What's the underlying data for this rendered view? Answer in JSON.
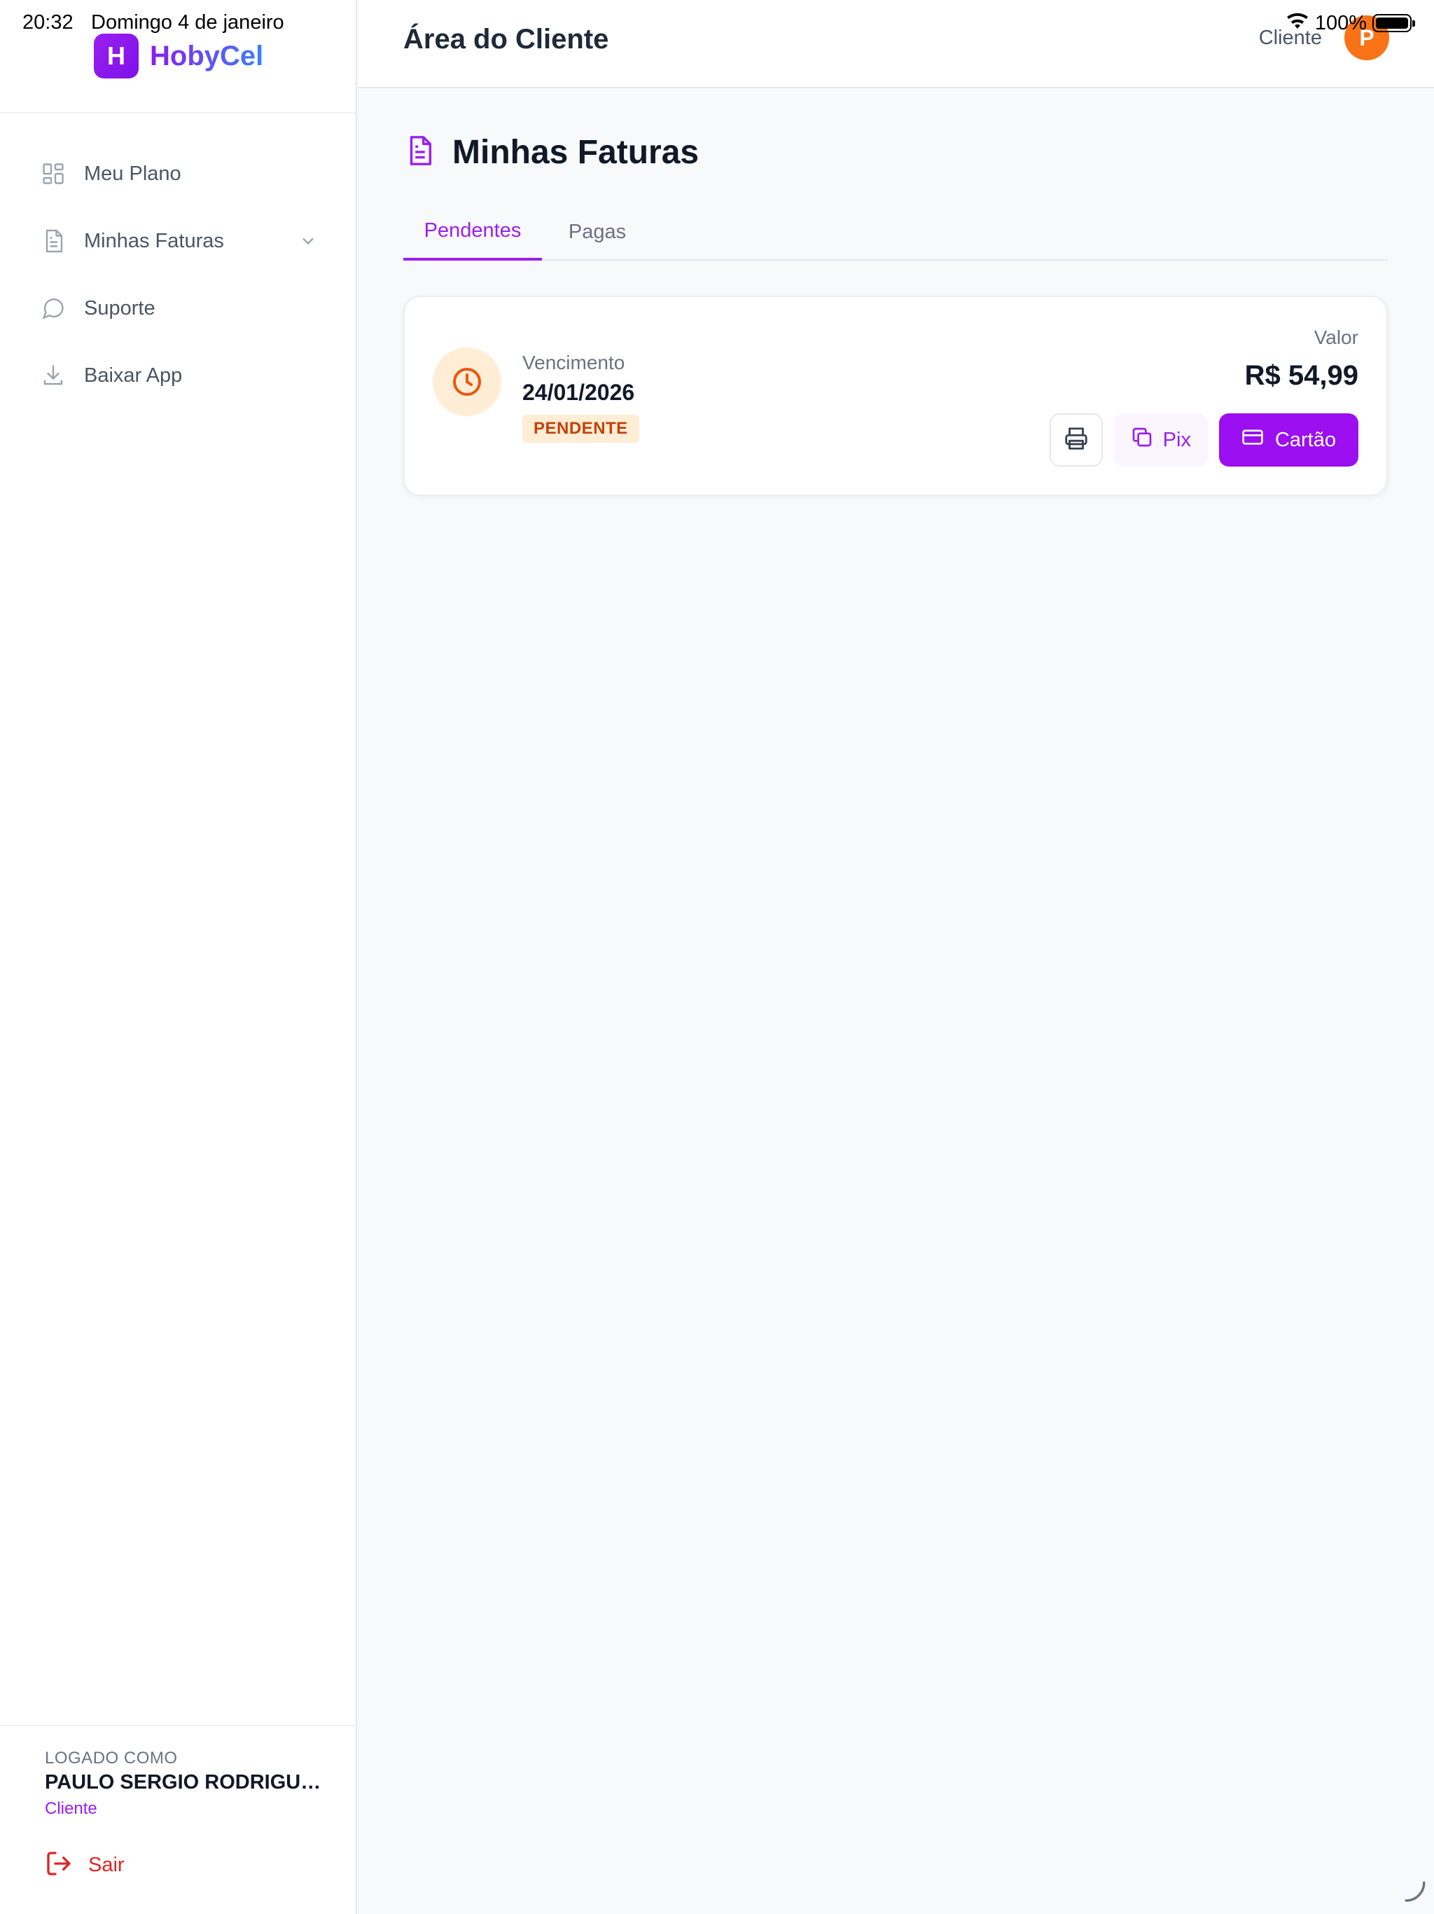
{
  "status_bar": {
    "time": "20:32",
    "date": "Domingo 4 de janeiro",
    "battery": "100%",
    "wifi_icon": "wifi-icon",
    "battery_icon": "battery-icon"
  },
  "brand": {
    "logo_letter": "H",
    "name": "HobyCel",
    "colors": {
      "primary": "#9b1ff0",
      "gradient_end": "#3b82f6"
    }
  },
  "sidebar": {
    "items": [
      {
        "label": "Meu Plano",
        "icon": "dashboard-icon"
      },
      {
        "label": "Minhas Faturas",
        "icon": "document-icon",
        "has_chevron": true
      },
      {
        "label": "Suporte",
        "icon": "chat-bubble-icon"
      },
      {
        "label": "Baixar App",
        "icon": "download-icon"
      }
    ],
    "user": {
      "logged_as_label": "LOGADO COMO",
      "name": "PAULO SERGIO RODRIGUES",
      "role": "Cliente"
    },
    "logout_label": "Sair"
  },
  "header": {
    "title": "Área do Cliente",
    "role": "Cliente",
    "avatar_letter": "P",
    "avatar_color": "#f97316"
  },
  "main": {
    "heading": "Minhas Faturas",
    "tabs": [
      {
        "label": "Pendentes",
        "active": true
      },
      {
        "label": "Pagas",
        "active": false
      }
    ],
    "invoice": {
      "due_label": "Vencimento",
      "due_date": "24/01/2026",
      "status": "PENDENTE",
      "value_label": "Valor",
      "value": "R$ 54,99",
      "actions": {
        "print_icon": "printer-icon",
        "pix_label": "Pix",
        "card_label": "Cartão"
      }
    }
  }
}
